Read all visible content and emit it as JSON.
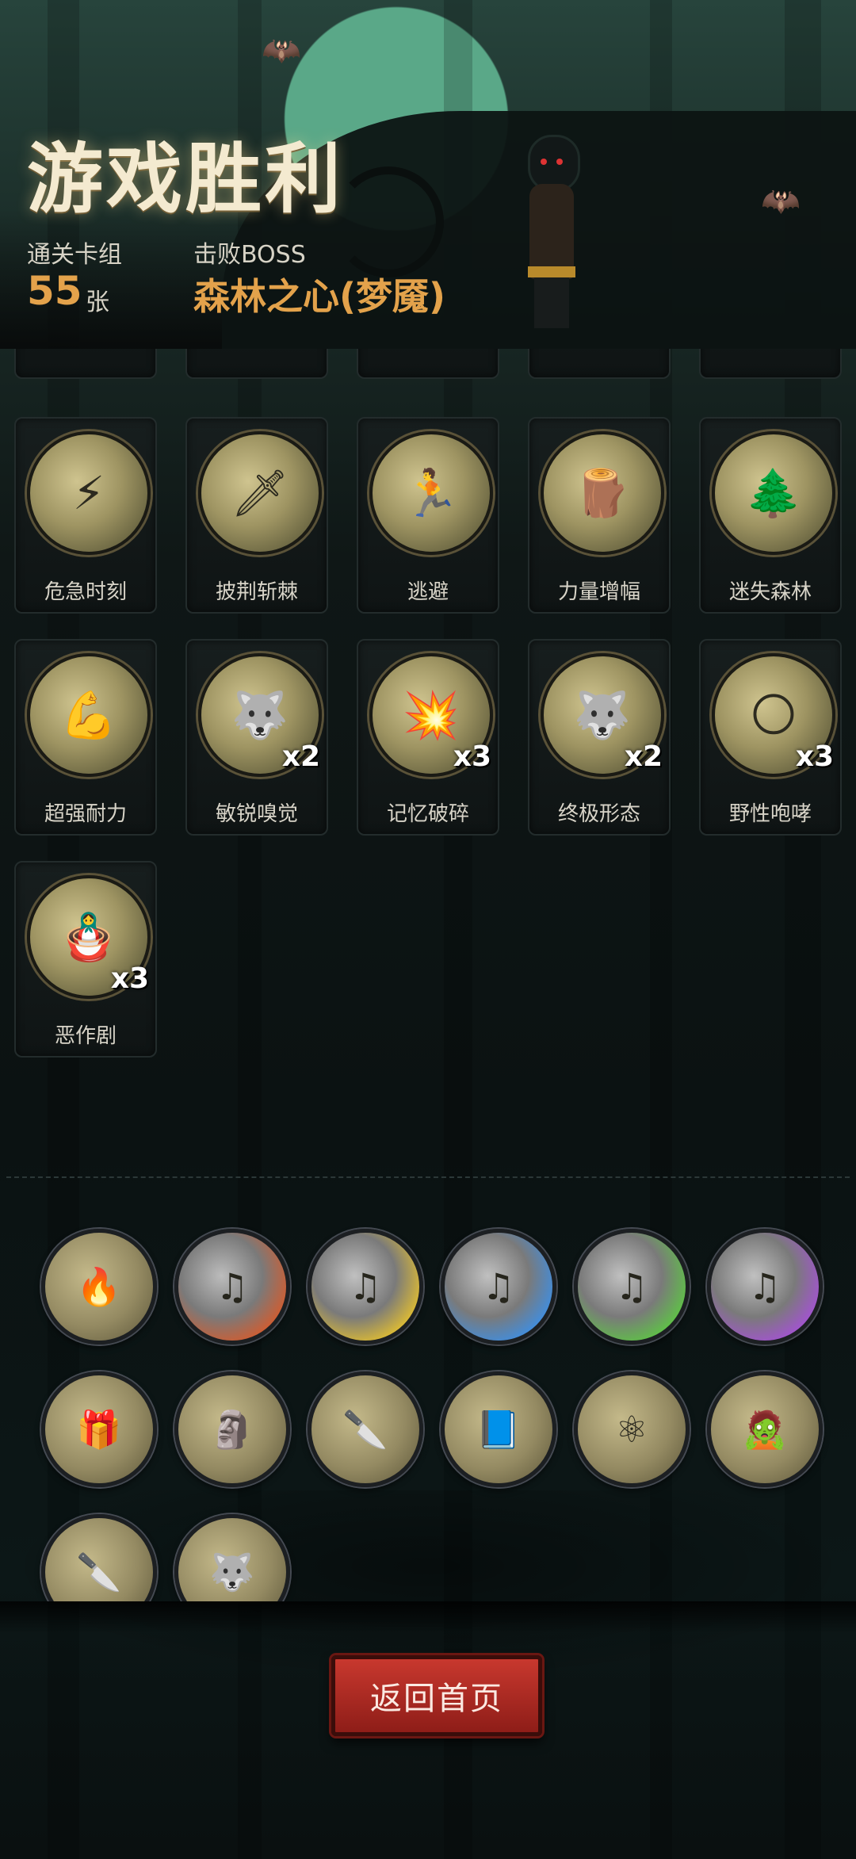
{
  "header": {
    "title": "游戏胜利",
    "decks_label": "通关卡组",
    "decks_count": "55",
    "decks_unit": "张",
    "boss_label": "击败BOSS",
    "boss_name": "森林之心(梦魇)"
  },
  "cards": [
    {
      "label": "危急时刻",
      "icon": "crisis-art",
      "count": ""
    },
    {
      "label": "披荆斩棘",
      "icon": "machete-art",
      "count": ""
    },
    {
      "label": "逃避",
      "icon": "flee-art",
      "count": ""
    },
    {
      "label": "力量增幅",
      "icon": "log-lift-art",
      "count": ""
    },
    {
      "label": "迷失森林",
      "icon": "lost-forest-art",
      "count": ""
    },
    {
      "label": "超强耐力",
      "icon": "endurance-art",
      "count": ""
    },
    {
      "label": "敏锐嗅觉",
      "icon": "wolf-art",
      "count": "x2"
    },
    {
      "label": "记忆破碎",
      "icon": "shattered-memory-art",
      "count": "x3"
    },
    {
      "label": "终极形态",
      "icon": "werewolf-art",
      "count": "x2"
    },
    {
      "label": "野性咆哮",
      "icon": "howl-art",
      "count": "x3"
    },
    {
      "label": "恶作剧",
      "icon": "doll-art",
      "count": "x3"
    }
  ],
  "relics": [
    {
      "icon": "campfire-knight-icon",
      "color": "brown"
    },
    {
      "icon": "red-music-skull-icon",
      "color": "red"
    },
    {
      "icon": "yellow-music-skull-icon",
      "color": "yellow"
    },
    {
      "icon": "blue-music-skull-icon",
      "color": "blue"
    },
    {
      "icon": "green-music-skull-icon",
      "color": "green"
    },
    {
      "icon": "purple-music-skull-icon",
      "color": "purple"
    },
    {
      "icon": "vip-gift-icon",
      "color": "brown"
    },
    {
      "icon": "statue-icon",
      "color": "brown"
    },
    {
      "icon": "rabbit-blade-icon",
      "color": "brown"
    },
    {
      "icon": "spellbook-icon",
      "color": "brown"
    },
    {
      "icon": "molecule-icon",
      "color": "brown"
    },
    {
      "icon": "zombie-scholar-icon",
      "color": "brown"
    },
    {
      "icon": "rabbit-blade-2-icon",
      "color": "brown"
    },
    {
      "icon": "werewolf-green-icon",
      "color": "brown"
    }
  ],
  "actions": {
    "return_home": "返回首页"
  },
  "colors": {
    "accent_gold": "#e3a24b",
    "button_red": "#b12a22"
  }
}
